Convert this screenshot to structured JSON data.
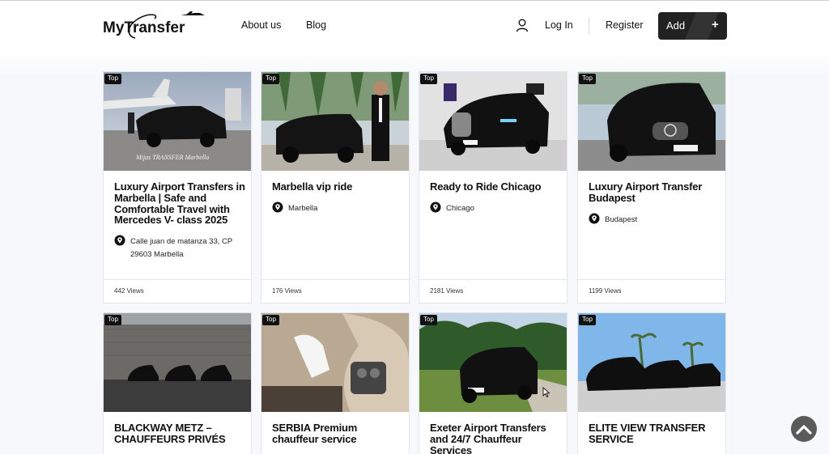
{
  "header": {
    "logo_text": "MyTransfer",
    "nav": {
      "about": "About us",
      "blog": "Blog"
    },
    "auth": {
      "login": "Log In",
      "register": "Register"
    },
    "add_button": {
      "label": "Add",
      "plus": "+"
    }
  },
  "icons": {
    "user": "user-icon",
    "pin": "map-pin-icon",
    "scroll_top": "chevron-up-icon"
  },
  "colors": {
    "dark": "#222222",
    "badge": "#111111",
    "page_bg": "#f7f8fc"
  },
  "listings": [
    {
      "badge": "Top",
      "title": "Luxury Airport Transfers in Marbella | Safe and Comfortable Travel with Mercedes V- class 2025",
      "location": "Calle juan de matanza 33, CP 29603 Marbella",
      "views": "442 Views",
      "photo_caption": "Mijas TRANSFER Marbella"
    },
    {
      "badge": "Top",
      "title": "Marbella vip ride",
      "location": "Marbella",
      "views": "176 Views"
    },
    {
      "badge": "Top",
      "title": "Ready to Ride Chicago",
      "location": "Chicago",
      "views": "2181 Views"
    },
    {
      "badge": "Top",
      "title": "Luxury Airport Transfer Budapest",
      "location": "Budapest",
      "views": "1199 Views"
    },
    {
      "badge": "Top",
      "title": "BLACKWAY METZ – CHAUFFEURS PRIVÉS"
    },
    {
      "badge": "Top",
      "title": "SERBIA Premium chauffeur service"
    },
    {
      "badge": "Top",
      "title": "Exeter Airport Transfers and 24/7 Chauffeur Services"
    },
    {
      "badge": "Top",
      "title": "ELITE VIEW TRANSFER SERVICE"
    }
  ]
}
